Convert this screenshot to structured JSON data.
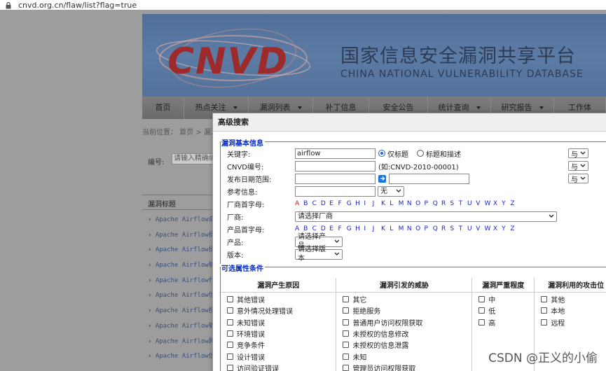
{
  "browser": {
    "url": "cnvd.org.cn/flaw/list?flag=true"
  },
  "banner": {
    "logo": "CNVD",
    "title_cn": "国家信息安全漏洞共享平台",
    "title_en": "CHINA NATIONAL VULNERABILITY DATABASE"
  },
  "nav": {
    "items": [
      {
        "label": "首页",
        "dropdown": false
      },
      {
        "label": "热点关注",
        "dropdown": true
      },
      {
        "label": "漏洞列表",
        "dropdown": true
      },
      {
        "label": "补丁信息",
        "dropdown": false
      },
      {
        "label": "安全公告",
        "dropdown": false
      },
      {
        "label": "统计查询",
        "dropdown": true
      },
      {
        "label": "研究报告",
        "dropdown": true
      },
      {
        "label": "工作体",
        "dropdown": false
      }
    ]
  },
  "breadcrumb": {
    "text": "当前位置： 首页 > 漏洞"
  },
  "page_search": {
    "label": "编号:",
    "placeholder": "请输入精确编号"
  },
  "list": {
    "header": "漏洞标题",
    "items": [
      "Apache Airflow命令",
      "Apache Airflow操作",
      "Apache Airflow操作",
      "Apache Airflow输入",
      "Apache Airflow代码",
      "Apache Airflow信息",
      "Apache Airflow授权",
      "Apache Airflow输入",
      "Apache Airflow跨站",
      "Apache Airflow信息"
    ]
  },
  "modal": {
    "title": "高级搜索",
    "basic_section": "漏洞基本信息",
    "keyword": {
      "label": "关键字:",
      "value": "airflow",
      "radio_title": "仅标题",
      "radio_both": "标题和描述",
      "selected": "仅标题"
    },
    "cnvd_id": {
      "label": "CNVD编号:",
      "hint": "(如:CNVD-2010-00001)"
    },
    "date_range": {
      "label": "发布日期范围:"
    },
    "reference": {
      "label": "参考信息:",
      "select_value": "无"
    },
    "vendor_letter": {
      "label": "厂商首字母:",
      "letters": [
        "A",
        "B",
        "C",
        "D",
        "E",
        "F",
        "G",
        "H",
        "I",
        "J",
        "K",
        "L",
        "M",
        "N",
        "O",
        "P",
        "Q",
        "R",
        "S",
        "T",
        "U",
        "V",
        "W",
        "X",
        "Y",
        "Z"
      ],
      "active": "A"
    },
    "vendor": {
      "label": "厂商:",
      "select_value": "请选择厂商"
    },
    "product_letter": {
      "label": "产品首字母:"
    },
    "product": {
      "label": "产品:",
      "select_value": "请选择产品"
    },
    "version": {
      "label": "版本:",
      "select_value": "请选择版本"
    },
    "logic_label": "与",
    "optional_section": "可选属性条件",
    "columns": [
      {
        "header": "漏洞产生原因",
        "items": [
          "其他错误",
          "意外情况处理错误",
          "未知错误",
          "环境错误",
          "竞争条件",
          "设计错误",
          "访问验证错误"
        ]
      },
      {
        "header": "漏洞引发的威胁",
        "items": [
          "其它",
          "拒绝服务",
          "普通用户访问权限获取",
          "未授权的信息修改",
          "未授权的信息泄露",
          "未知",
          "管理员访问权限获取"
        ]
      },
      {
        "header": "漏洞严重程度",
        "items": [
          "中",
          "低",
          "高"
        ]
      },
      {
        "header": "漏洞利用的攻击位",
        "items": [
          "其他",
          "本地",
          "远程"
        ]
      }
    ]
  },
  "watermark": "CSDN @正义的小偷",
  "colors": {
    "link": "#1a24c8",
    "section": "#0a2cbf",
    "active_letter": "#d41010",
    "radio": "#1a66d2"
  }
}
